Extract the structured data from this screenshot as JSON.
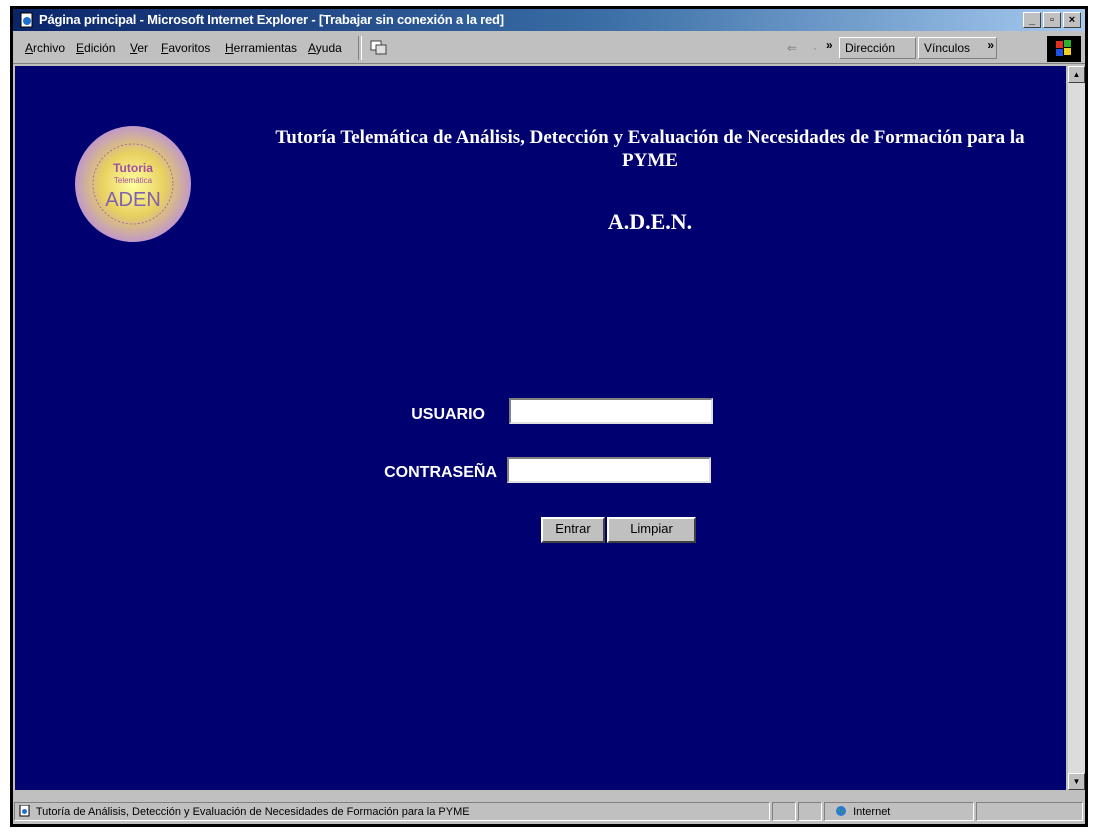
{
  "window": {
    "title": "Página principal - Microsoft Internet Explorer - [Trabajar sin conexión a la red]",
    "controls": {
      "minimize": "_",
      "maximize": "▫",
      "close": "×"
    }
  },
  "menu": {
    "items": [
      "Archivo",
      "Edición",
      "Ver",
      "Favoritos",
      "Herramientas",
      "Ayuda"
    ],
    "back_arrow": "⇐",
    "chevron": "»",
    "address_label": "Dirección",
    "links_label": "Vínculos"
  },
  "page": {
    "logo_text": {
      "top": "Tutoria",
      "middle": "Telemática",
      "bottom": "ADEN"
    },
    "heading": "Tutoría Telemática de Análisis, Detección y Evaluación de Necesidades de Formación para la PYME",
    "acronym": "A.D.E.N.",
    "login": {
      "user_label": "USUARIO",
      "user_value": "",
      "password_label": "CONTRASEÑA",
      "password_value": "",
      "submit": "Entrar",
      "reset": "Limpiar"
    }
  },
  "status": {
    "text": "Tutoría de Análisis, Detección y Evaluación de Necesidades de Formación para la PYME",
    "zone": "Internet"
  },
  "colors": {
    "page_background": "#000070",
    "title_bar": "#0a246a",
    "text": "#ffffff"
  }
}
